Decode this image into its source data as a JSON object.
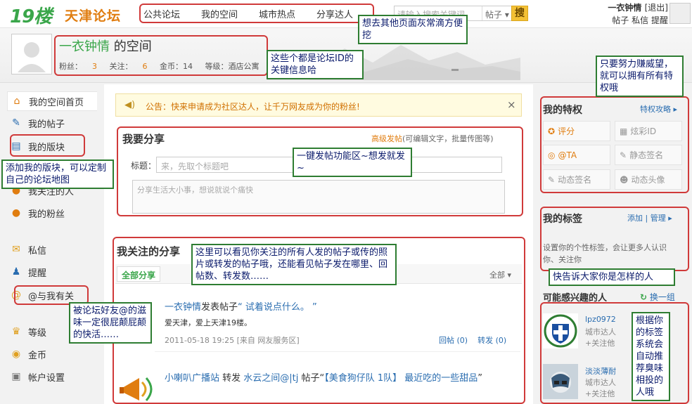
{
  "topbar": {
    "logo_number": "19楼",
    "logo_text": "天津论坛",
    "nav": [
      "公共论坛",
      "我的空间",
      "城市热点",
      "分享达人"
    ],
    "search_placeholder": "请输入搜索关键词",
    "search_type": "帖子 ▾",
    "search_button": "搜",
    "username": "一衣钟情",
    "logout": "[退出]",
    "links": [
      "帖子",
      "私信",
      "提醒"
    ]
  },
  "profile": {
    "name": "一衣钟情",
    "title_suffix": " 的空间",
    "fans_label": "粉丝：",
    "fans": "3",
    "follow_label": "关注：",
    "follow": "6",
    "coins": "金币：14",
    "level": "等级：酒店公寓"
  },
  "leftnav": {
    "items": [
      "我的空间首页",
      "我的帖子",
      "我的版块",
      "我关注的人",
      "我的粉丝",
      "私信",
      "提醒",
      "@与我有关",
      "等级",
      "金币",
      "帐户设置"
    ],
    "icons": [
      "house-icon",
      "post-icon",
      "board-icon",
      "follow-icon",
      "fans-icon",
      "mail-icon",
      "bell-icon",
      "at-icon",
      "crown-icon",
      "coin-icon",
      "gear-icon"
    ]
  },
  "notice": {
    "text": "公告：快来申请成为社区达人，让千万网友成为你的粉丝!",
    "close": "×"
  },
  "share": {
    "title": "我要分享",
    "advanced": "高级发帖",
    "advanced_desc": "(可编辑文字，批量传图等)",
    "title_label": "标题：",
    "title_placeholder": "来，先取个标题吧",
    "content_placeholder": "分享生活大小事，想说就说个痛快"
  },
  "feed": {
    "title": "我关注的分享",
    "tab_all": "全部分享",
    "filter": "全部 ▾",
    "post1": {
      "author": "一衣钟情",
      "verb": "发表帖子",
      "quote": "“ 试着说点什么。 ”",
      "body": "爱天津，爱上天津19楼。",
      "meta": "2011-05-18 19:25   [来自 网友服务区]",
      "replies": "回帖 (0)",
      "forwards": "转发 (0)"
    },
    "post2": {
      "author": "小喇叭广播站",
      "verb": " 转发 ",
      "source": "水云之间@|tj",
      "mid": " 帖子“",
      "title": "【美食狗仔队 1队】 最近吃的一些甜品",
      "end": "”"
    }
  },
  "privileges": {
    "title": "我的特权",
    "guide": "特权攻略 ▸",
    "items": [
      {
        "label": "评分",
        "icon": "star-icon",
        "state": "on"
      },
      {
        "label": "炫彩ID",
        "icon": "id-icon",
        "state": "off"
      },
      {
        "label": "@TA",
        "icon": "at-icon",
        "state": "on"
      },
      {
        "label": "静态签名",
        "icon": "pen-icon",
        "state": "off"
      },
      {
        "label": "动态签名",
        "icon": "pen-icon",
        "state": "off"
      },
      {
        "label": "动态头像",
        "icon": "avatar-icon",
        "state": "off"
      }
    ]
  },
  "tags": {
    "title": "我的标签",
    "add": "添加",
    "manage": "管理 ▸",
    "desc": "设置你的个性标签，会让更多人认识你、关注你"
  },
  "interest": {
    "title": "可能感兴趣的人",
    "change": "换一组",
    "people": [
      {
        "name": "lpz0972",
        "city": "城市达人",
        "follow": "+关注他"
      },
      {
        "name": "淡淡薄耐",
        "city": "城市达人",
        "follow": "+关注他"
      }
    ]
  },
  "annotations": [
    "想去其他页面灰常滴方便挖",
    "这些个都是论坛ID的关键信息哈",
    "只要努力赚威望，就可以拥有所有特权哦",
    "添加我的版块，可以定制自己的论坛地图",
    "一键发帖功能区~想发就发~",
    "这里可以看见你关注的所有人发的帖子或传的照片或转发的帖子哦，还能看见帖子发在哪里、回帖数、转发数……",
    "快告诉大家你是怎样的人",
    "被论坛好友@的滋味一定很屁颠屁颠的快活……",
    "根据你的标签系统会自动推荐臭味相投的人哦"
  ],
  "colors": {
    "brand_green": "#3aa64a",
    "brand_orange": "#e07d10",
    "link_blue": "#2a6db0",
    "annotation_red": "#d03a3a",
    "note_border": "#2e7d32"
  }
}
